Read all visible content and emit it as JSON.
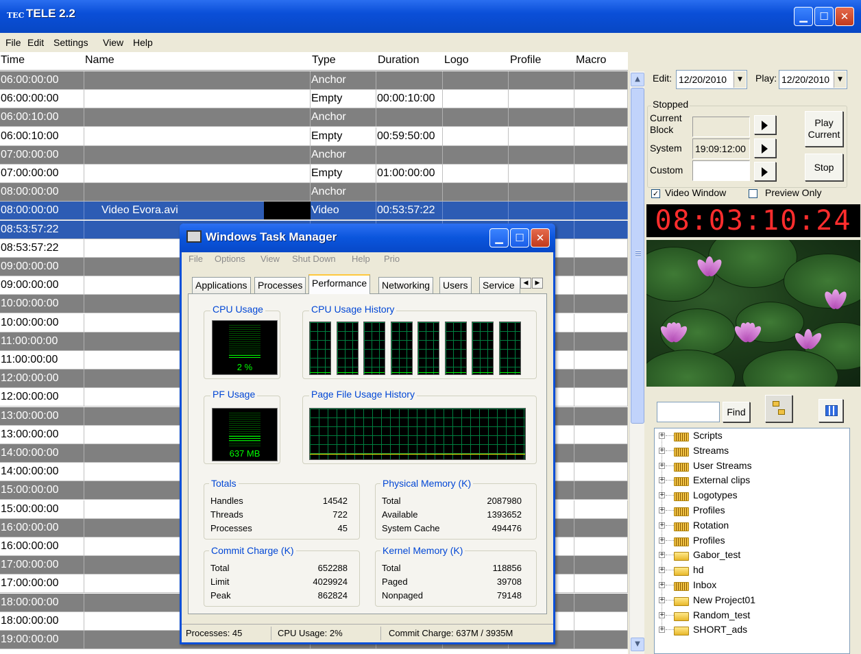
{
  "window": {
    "title": "TELE 2.2",
    "logo_text": "TEC"
  },
  "menu": [
    "File",
    "Edit",
    "Settings",
    "View",
    "Help"
  ],
  "grid": {
    "headers": {
      "time": "Time",
      "name": "Name",
      "type": "Type",
      "duration": "Duration",
      "logo": "Logo",
      "profile": "Profile",
      "macro": "Macro"
    },
    "rows": [
      {
        "time": "06:00:00:00",
        "name": "",
        "type": "Anchor",
        "duration": "",
        "style": "gray"
      },
      {
        "time": "06:00:00:00",
        "name": "",
        "type": "Empty",
        "duration": "00:00:10:00",
        "style": "white"
      },
      {
        "time": "06:00:10:00",
        "name": "",
        "type": "Anchor",
        "duration": "",
        "style": "gray"
      },
      {
        "time": "06:00:10:00",
        "name": "",
        "type": "Empty",
        "duration": "00:59:50:00",
        "style": "white"
      },
      {
        "time": "07:00:00:00",
        "name": "",
        "type": "Anchor",
        "duration": "",
        "style": "gray"
      },
      {
        "time": "07:00:00:00",
        "name": "",
        "type": "Empty",
        "duration": "01:00:00:00",
        "style": "white"
      },
      {
        "time": "08:00:00:00",
        "name": "",
        "type": "Anchor",
        "duration": "",
        "style": "gray"
      },
      {
        "time": "08:00:00:00",
        "name": "Video Evora.avi",
        "type": "Video",
        "duration": "00:53:57:22",
        "style": "sel"
      },
      {
        "time": "08:53:57:22",
        "name": "",
        "type": "",
        "duration": "",
        "style": "sel"
      },
      {
        "time": "08:53:57:22",
        "name": "",
        "type": "",
        "duration": "",
        "style": "white"
      },
      {
        "time": "09:00:00:00",
        "name": "",
        "type": "",
        "duration": "",
        "style": "gray"
      },
      {
        "time": "09:00:00:00",
        "name": "",
        "type": "",
        "duration": "",
        "style": "white"
      },
      {
        "time": "10:00:00:00",
        "name": "",
        "type": "",
        "duration": "",
        "style": "gray"
      },
      {
        "time": "10:00:00:00",
        "name": "",
        "type": "",
        "duration": "",
        "style": "white"
      },
      {
        "time": "11:00:00:00",
        "name": "",
        "type": "",
        "duration": "",
        "style": "gray"
      },
      {
        "time": "11:00:00:00",
        "name": "",
        "type": "",
        "duration": "",
        "style": "white"
      },
      {
        "time": "12:00:00:00",
        "name": "",
        "type": "",
        "duration": "",
        "style": "gray"
      },
      {
        "time": "12:00:00:00",
        "name": "",
        "type": "",
        "duration": "",
        "style": "white"
      },
      {
        "time": "13:00:00:00",
        "name": "",
        "type": "",
        "duration": "",
        "style": "gray"
      },
      {
        "time": "13:00:00:00",
        "name": "",
        "type": "",
        "duration": "",
        "style": "white"
      },
      {
        "time": "14:00:00:00",
        "name": "",
        "type": "",
        "duration": "",
        "style": "gray"
      },
      {
        "time": "14:00:00:00",
        "name": "",
        "type": "",
        "duration": "",
        "style": "white"
      },
      {
        "time": "15:00:00:00",
        "name": "",
        "type": "",
        "duration": "",
        "style": "gray"
      },
      {
        "time": "15:00:00:00",
        "name": "",
        "type": "",
        "duration": "",
        "style": "white"
      },
      {
        "time": "16:00:00:00",
        "name": "",
        "type": "",
        "duration": "",
        "style": "gray"
      },
      {
        "time": "16:00:00:00",
        "name": "",
        "type": "",
        "duration": "",
        "style": "white"
      },
      {
        "time": "17:00:00:00",
        "name": "",
        "type": "",
        "duration": "",
        "style": "gray"
      },
      {
        "time": "17:00:00:00",
        "name": "",
        "type": "",
        "duration": "",
        "style": "white"
      },
      {
        "time": "18:00:00:00",
        "name": "",
        "type": "",
        "duration": "",
        "style": "gray"
      },
      {
        "time": "18:00:00:00",
        "name": "",
        "type": "",
        "duration": "",
        "style": "white"
      },
      {
        "time": "19:00:00:00",
        "name": "",
        "type": "",
        "duration": "",
        "style": "gray"
      }
    ]
  },
  "control": {
    "edit_label": "Edit:",
    "edit_date": "12/20/2010",
    "play_label": "Play:",
    "play_date": "12/20/2010",
    "status": "Stopped",
    "current_block_label": "Current Block",
    "current_block_value": "",
    "system_label": "System",
    "system_value": "19:09:12:00",
    "custom_label": "Custom",
    "custom_value": "",
    "play_current": "Play Current",
    "stop": "Stop",
    "video_window": "Video Window",
    "video_window_checked": true,
    "preview_only": "Preview Only",
    "preview_only_checked": false,
    "clock": "08:03:10:24"
  },
  "library": {
    "find_label": "Find",
    "find_value": "",
    "items": [
      "Scripts",
      "Streams",
      "User Streams",
      "External clips",
      "Logotypes",
      "Profiles",
      "Rotation",
      "Profiles",
      "Gabor_test",
      "hd",
      "Inbox",
      "New Project01",
      "Random_test",
      "SHORT_ads"
    ]
  },
  "taskmgr": {
    "title": "Windows Task Manager",
    "menu": [
      "File",
      "Options",
      "View",
      "Shut Down",
      "Help",
      "Prio"
    ],
    "tabs": [
      "Applications",
      "Processes",
      "Performance",
      "Networking",
      "Users",
      "Service"
    ],
    "active_tab": "Performance",
    "cpu_usage_title": "CPU Usage",
    "cpu_usage_value": "2 %",
    "cpu_usage_level": 0.02,
    "cpu_history_title": "CPU Usage History",
    "pf_usage_title": "PF Usage",
    "pf_usage_value": "637 MB",
    "pf_history_title": "Page File Usage History",
    "totals": {
      "title": "Totals",
      "rows": [
        [
          "Handles",
          "14542"
        ],
        [
          "Threads",
          "722"
        ],
        [
          "Processes",
          "45"
        ]
      ]
    },
    "physical": {
      "title": "Physical Memory (K)",
      "rows": [
        [
          "Total",
          "2087980"
        ],
        [
          "Available",
          "1393652"
        ],
        [
          "System Cache",
          "494476"
        ]
      ]
    },
    "commit": {
      "title": "Commit Charge (K)",
      "rows": [
        [
          "Total",
          "652288"
        ],
        [
          "Limit",
          "4029924"
        ],
        [
          "Peak",
          "862824"
        ]
      ]
    },
    "kernel": {
      "title": "Kernel Memory (K)",
      "rows": [
        [
          "Total",
          "118856"
        ],
        [
          "Paged",
          "39708"
        ],
        [
          "Nonpaged",
          "79148"
        ]
      ]
    },
    "status": {
      "processes": "Processes: 45",
      "cpu": "CPU Usage: 2%",
      "commit": "Commit Charge: 637M / 3935M"
    }
  },
  "colors": {
    "row_gray": "#808080",
    "row_selected": "#2d5cb4",
    "clock": "#ff2d2d",
    "titlebar": "#0a4fd8"
  }
}
